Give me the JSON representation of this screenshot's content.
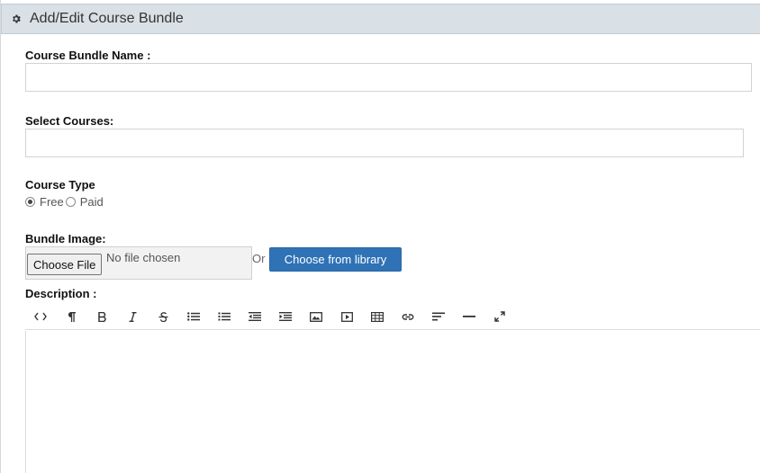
{
  "header": {
    "title": "Add/Edit Course Bundle",
    "icon": "gear-icon"
  },
  "bundle_name": {
    "label": "Course Bundle Name :",
    "value": ""
  },
  "courses": {
    "label": "Select Courses:",
    "value": ""
  },
  "course_type": {
    "label": "Course Type",
    "options": [
      {
        "label": "Free",
        "checked": true
      },
      {
        "label": "Paid",
        "checked": false
      }
    ]
  },
  "image": {
    "label": "Bundle Image:",
    "choose_file": "Choose File",
    "no_file": "No file chosen",
    "or": "Or",
    "library": "Choose from library"
  },
  "description": {
    "label": "Description :"
  },
  "toolbar": [
    "code-view-icon",
    "paragraph-icon",
    "bold-icon",
    "italic-icon",
    "strikethrough-icon",
    "unordered-list-icon",
    "ordered-list-icon",
    "outdent-icon",
    "indent-icon",
    "image-icon",
    "video-icon",
    "table-icon",
    "link-icon",
    "align-icon",
    "horizontal-rule-icon",
    "fullscreen-icon"
  ],
  "colors": {
    "header_bg": "#d9e0e6",
    "primary_button": "#2f72b6"
  }
}
